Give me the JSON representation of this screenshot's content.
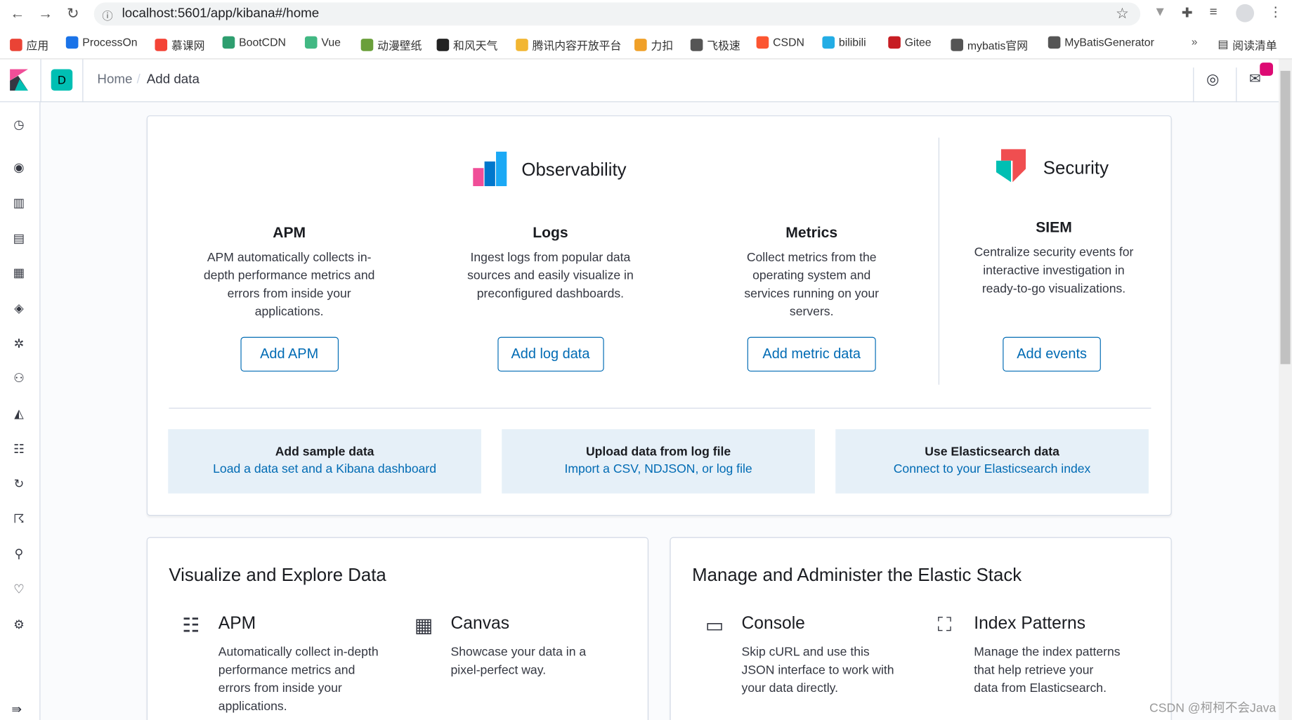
{
  "browser": {
    "url": "localhost:5601/app/kibana#/home",
    "bookmarks": [
      {
        "label": "应用",
        "color": "#ea4335"
      },
      {
        "label": "ProcessOn",
        "color": "#1a73e8"
      },
      {
        "label": "慕课网",
        "color": "#f44336"
      },
      {
        "label": "BootCDN",
        "color": "#2e9e6f"
      },
      {
        "label": "Vue",
        "color": "#41b883"
      },
      {
        "label": "动漫壁纸",
        "color": "#6a9f3a"
      },
      {
        "label": "和风天气",
        "color": "#222"
      },
      {
        "label": "腾讯内容开放平台",
        "color": "#f2b632"
      },
      {
        "label": "力扣",
        "color": "#f0a028"
      },
      {
        "label": "飞极速",
        "color": "#555"
      },
      {
        "label": "CSDN",
        "color": "#fc5531"
      },
      {
        "label": "bilibili",
        "color": "#23ade5"
      },
      {
        "label": "Gitee",
        "color": "#c71d23"
      },
      {
        "label": "mybatis官网",
        "color": "#555"
      },
      {
        "label": "MyBatisGenerator",
        "color": "#555"
      }
    ],
    "more": "»",
    "reading_list": "阅读清单"
  },
  "header": {
    "space_initial": "D",
    "breadcrumbs": [
      "Home",
      "Add data"
    ],
    "accent": "#00bfb3",
    "badge_color": "#dd0a73"
  },
  "solutions": {
    "observability": {
      "title": "Observability",
      "items": [
        {
          "title": "APM",
          "desc": "APM automatically collects in-depth performance metrics and errors from inside your applications.",
          "button": "Add APM"
        },
        {
          "title": "Logs",
          "desc": "Ingest logs from popular data sources and easily visualize in preconfigured dashboards.",
          "button": "Add log data"
        },
        {
          "title": "Metrics",
          "desc": "Collect metrics from the operating system and services running on your servers.",
          "button": "Add metric data"
        }
      ]
    },
    "security": {
      "title": "Security",
      "item": {
        "title": "SIEM",
        "desc": "Centralize security events for interactive investigation in ready-to-go visualizations.",
        "button": "Add events"
      }
    }
  },
  "tiles": [
    {
      "title": "Add sample data",
      "link": "Load a data set and a Kibana dashboard"
    },
    {
      "title": "Upload data from log file",
      "link": "Import a CSV, NDJSON, or log file"
    },
    {
      "title": "Use Elasticsearch data",
      "link": "Connect to your Elasticsearch index"
    }
  ],
  "visualize": {
    "title": "Visualize and Explore Data",
    "features": [
      {
        "title": "APM",
        "desc": "Automatically collect in-depth performance metrics and errors from inside your applications."
      },
      {
        "title": "Canvas",
        "desc": "Showcase your data in a pixel-perfect way."
      }
    ]
  },
  "manage": {
    "title": "Manage and Administer the Elastic Stack",
    "features": [
      {
        "title": "Console",
        "desc": "Skip cURL and use this JSON interface to work with your data directly."
      },
      {
        "title": "Index Patterns",
        "desc": "Manage the index patterns that help retrieve your data from Elasticsearch."
      }
    ]
  },
  "watermark": "CSDN @柯柯不会Java"
}
